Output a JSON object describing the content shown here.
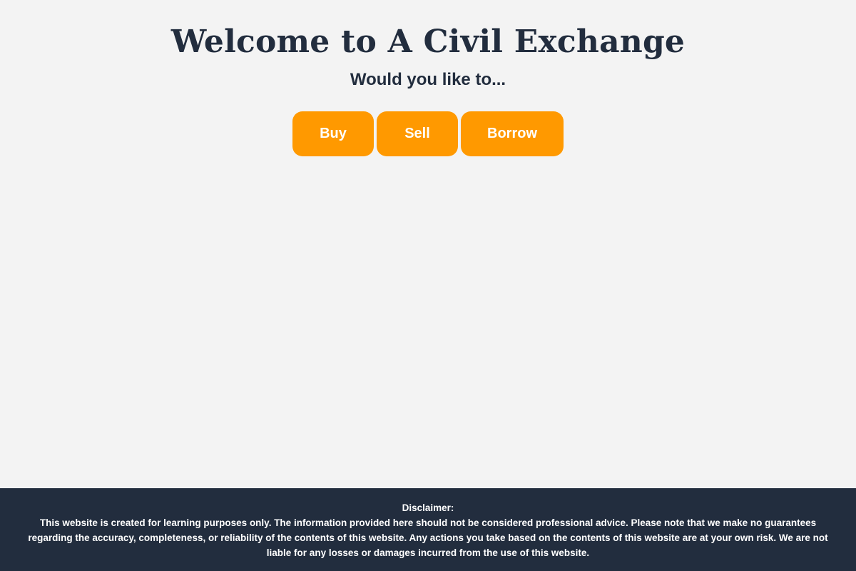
{
  "hero": {
    "title": "Welcome to A Civil Exchange",
    "subtitle": "Would you like to..."
  },
  "actions": {
    "buy_label": "Buy",
    "sell_label": "Sell",
    "borrow_label": "Borrow"
  },
  "footer": {
    "disclaimer_label": "Disclaimer:",
    "disclaimer_text": "This website is created for learning purposes only. The information provided here should not be considered professional advice. Please note that we make no guarantees regarding the accuracy, completeness, or reliability of the contents of this website. Any actions you take based on the contents of this website are at your own risk. We are not liable for any losses or damages incurred from the use of this website."
  },
  "colors": {
    "background": "#f3f3f3",
    "heading": "#222d3e",
    "accent": "#ff9900",
    "footer_bg": "#222d3e",
    "footer_text": "#ffffff"
  }
}
